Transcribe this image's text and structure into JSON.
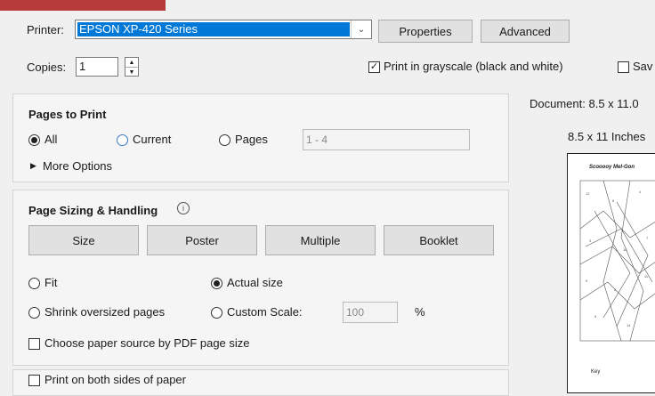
{
  "printer": {
    "label": "Printer:",
    "selected": "EPSON XP-420 Series",
    "properties_label": "Properties",
    "advanced_label": "Advanced"
  },
  "copies": {
    "label": "Copies:",
    "value": "1"
  },
  "grayscale": {
    "label": "Print in grayscale (black and white)",
    "checked": true
  },
  "save_ink": {
    "label": "Sav"
  },
  "pages_to_print": {
    "title": "Pages to Print",
    "all_label": "All",
    "current_label": "Current",
    "pages_label": "Pages",
    "pages_value": "1 - 4",
    "more_options": "More Options"
  },
  "sizing": {
    "title": "Page Sizing & Handling",
    "size_label": "Size",
    "poster_label": "Poster",
    "multiple_label": "Multiple",
    "booklet_label": "Booklet",
    "fit_label": "Fit",
    "actual_label": "Actual size",
    "shrink_label": "Shrink oversized pages",
    "custom_label": "Custom Scale:",
    "custom_value": "100",
    "percent": "%",
    "paper_source_label": "Choose paper source by PDF page size"
  },
  "both_sides": {
    "label": "Print on both sides of paper"
  },
  "preview": {
    "document_label": "Document: 8.5 x 11.0",
    "paper_label": "8.5 x 11 Inches",
    "page_title": "Scooooy Mel-Gon",
    "key_label": "Key"
  }
}
